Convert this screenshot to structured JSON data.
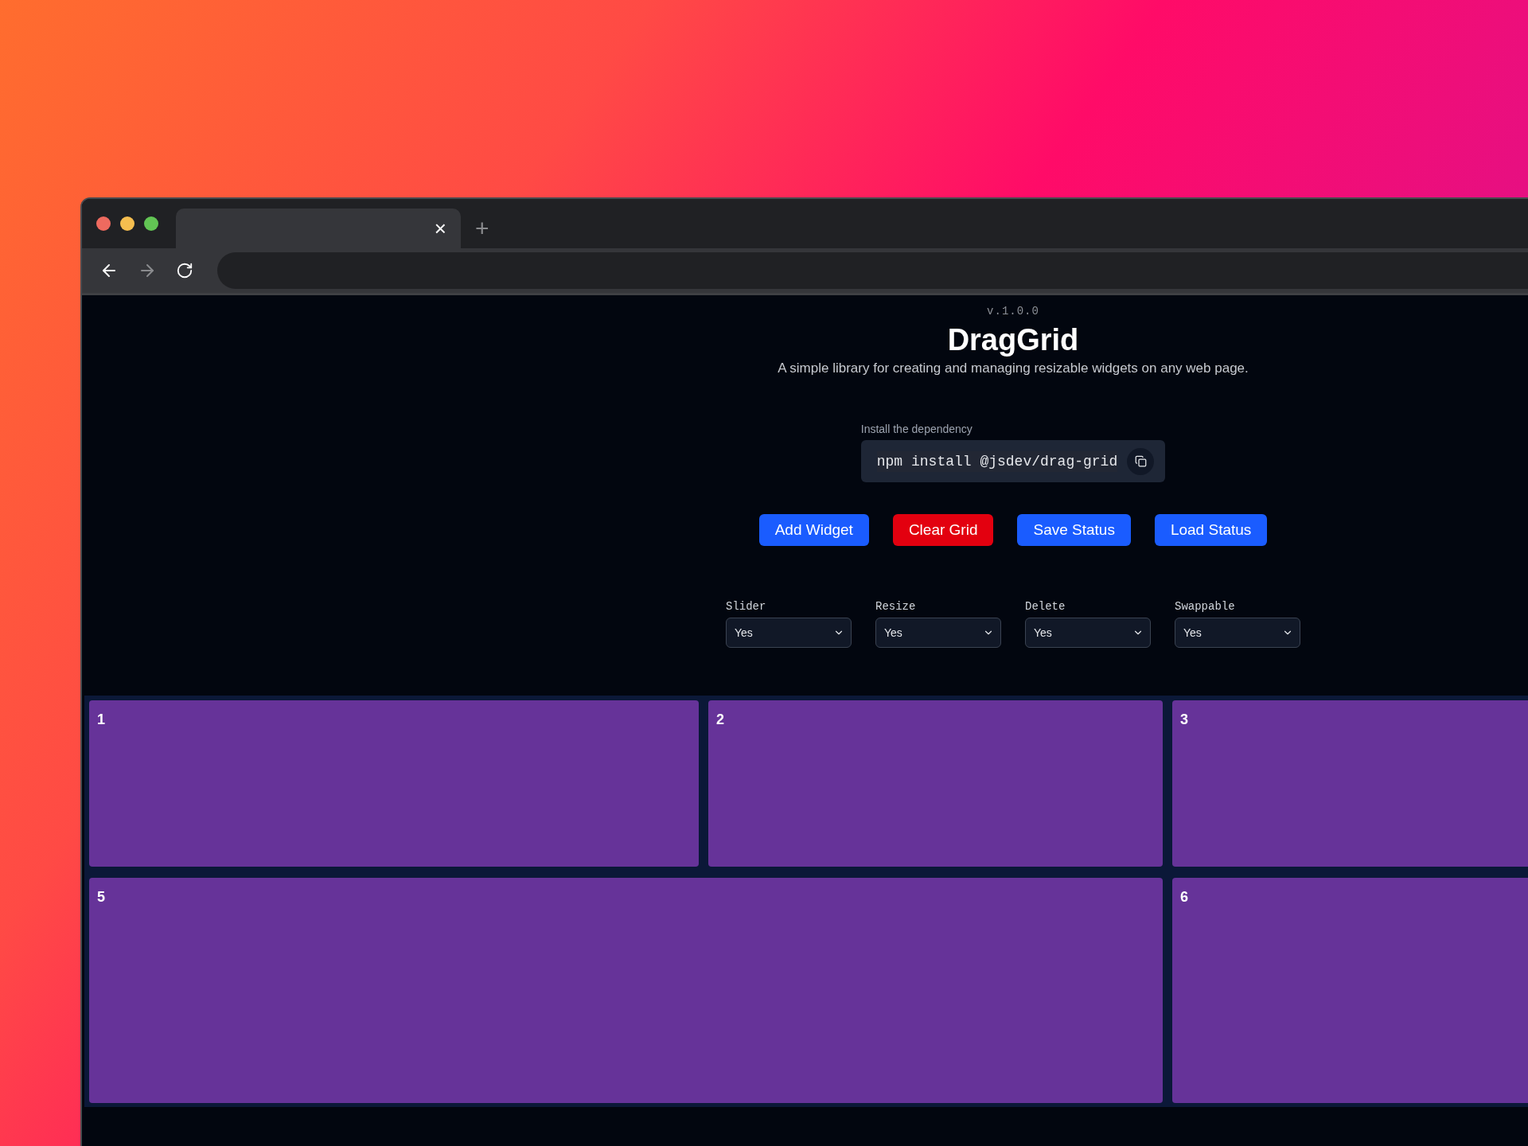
{
  "browser": {
    "tab": {
      "close": "×"
    },
    "new_tab": "+",
    "nav": {
      "back_disabled": false,
      "forward_disabled": true
    }
  },
  "page": {
    "version": "v.1.0.0",
    "title": "DragGrid",
    "subtitle": "A simple library for creating and managing resizable widgets on any web page.",
    "install": {
      "label": "Install the dependency",
      "command": "npm install @jsdev/drag-grid"
    },
    "buttons": [
      {
        "label": "Add Widget",
        "kind": "primary"
      },
      {
        "label": "Clear Grid",
        "kind": "danger"
      },
      {
        "label": "Save Status",
        "kind": "primary"
      },
      {
        "label": "Load Status",
        "kind": "primary"
      }
    ],
    "options": [
      {
        "label": "Slider",
        "value": "Yes"
      },
      {
        "label": "Resize",
        "value": "Yes"
      },
      {
        "label": "Delete",
        "value": "Yes"
      },
      {
        "label": "Swappable",
        "value": "Yes"
      }
    ],
    "widgets": [
      {
        "label": "1"
      },
      {
        "label": "2"
      },
      {
        "label": "3"
      },
      {
        "label": "5"
      },
      {
        "label": "6"
      }
    ]
  }
}
